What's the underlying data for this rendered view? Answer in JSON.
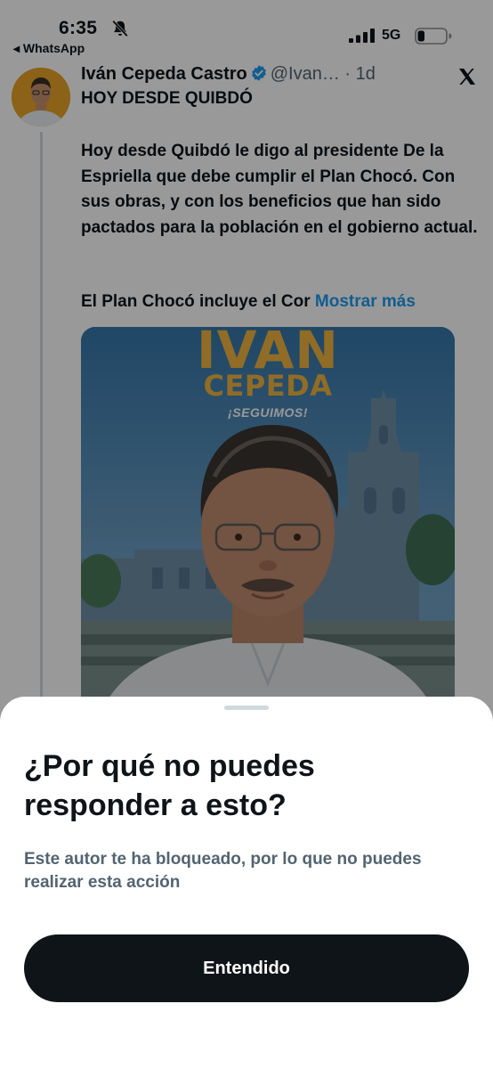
{
  "status_bar": {
    "time": "6:35",
    "back_app": "◂ WhatsApp",
    "network": "5G",
    "icons": [
      "bell-slash-icon",
      "signal-icon",
      "battery-icon"
    ]
  },
  "tweet": {
    "author_name": "Iván Cepeda Castro",
    "handle": "@Ivan…",
    "separator": "·",
    "time_ago": "1d",
    "title": "HOY DESDE QUIBDÓ",
    "body": "Hoy desde Quibdó le digo al presidente De la Espriella que debe cumplir el Plan Chocó. Con sus obras, y con los beneficios que han sido pactados para la población en el gobierno actual.",
    "truncated_line": "El Plan Chocó incluye el Cor",
    "show_more": "Mostrar más",
    "media": {
      "title_line_1": "IVÁN",
      "title_line_2": "CEPEDA",
      "slogan": "¡SEGUIMOS!"
    }
  },
  "sheet": {
    "title": "¿Por qué no puedes responder a esto?",
    "description": "Este autor te ha bloqueado, por lo que no puedes realizar esta acción",
    "button_label": "Entendido"
  },
  "colors": {
    "text_primary": "#0f1419",
    "text_secondary": "#536471",
    "link": "#1d9bf0",
    "verified": "#1d9bf0",
    "button_bg": "#0f1419",
    "scrim": "rgba(0,0,0,0.4)"
  }
}
